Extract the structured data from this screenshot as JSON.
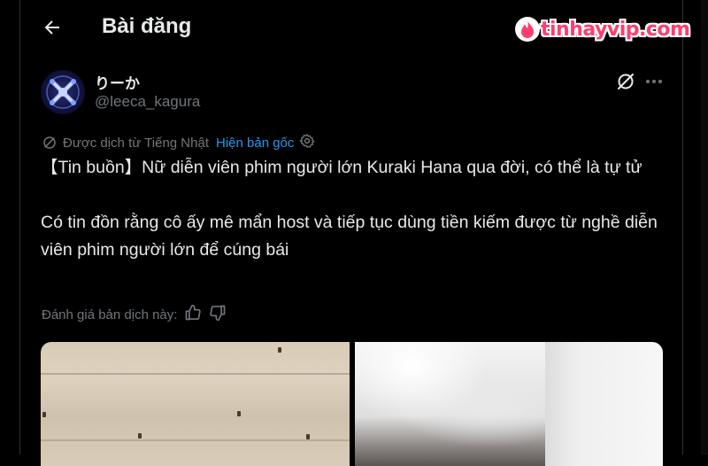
{
  "header": {
    "title": "Bài đăng"
  },
  "watermark": {
    "text": "tinhayvip.com"
  },
  "post": {
    "display_name": "りーか",
    "handle": "@leeca_kagura",
    "translation_note": "Được dịch từ Tiếng Nhật",
    "show_original_label": "Hiện bản gốc",
    "text": "【Tin buồn】Nữ diễn viên phim người lớn Kuraki Hana qua đời, có thể là tự tử\n\nCó tin đồn rằng cô ấy mê mẩn host và tiếp tục dùng tiền kiếm được từ nghề diễn viên phim người lớn để cúng bái",
    "rate_translation_label": "Đánh giá bản dịch này:"
  },
  "icons": {
    "back": "arrow-left-icon",
    "grok": "grok-icon",
    "more": "more-horizontal-icon",
    "translate": "translate-icon",
    "settings": "gear-icon",
    "thumbs_up": "thumbs-up-icon",
    "thumbs_down": "thumbs-down-icon"
  },
  "colors": {
    "background": "#000000",
    "text": "#e7e9ea",
    "muted": "#71767b",
    "link": "#1d9bf0",
    "watermark": "#ff3d6e"
  }
}
